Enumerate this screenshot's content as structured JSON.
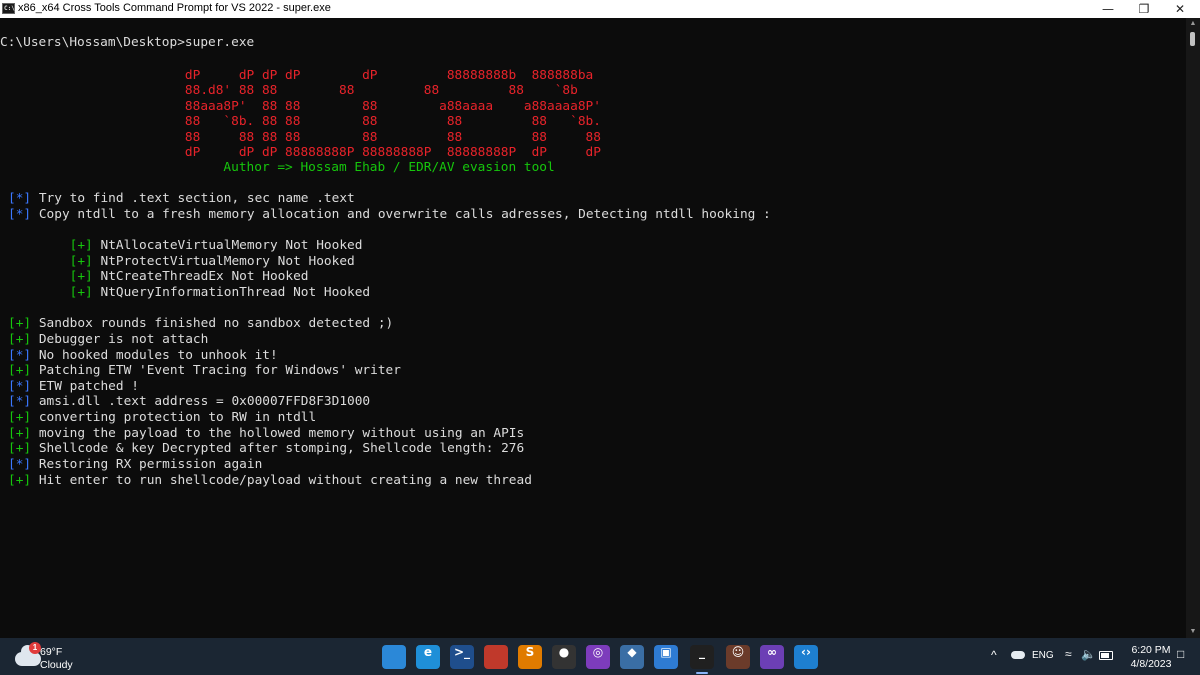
{
  "window": {
    "title": "x86_x64 Cross Tools Command Prompt for VS 2022 - super.exe",
    "icon_text": "C:\\",
    "minimize_icon": "minimize-icon",
    "restore_icon": "restore-icon",
    "close_icon": "close-icon"
  },
  "console": {
    "prompt": "C:\\Users\\Hossam\\Desktop>super.exe",
    "banner": [
      "                        dP     dP dP dP        dP         88888888b  888888ba ",
      "                        88.d8' 88 88        88         88         88    `8b",
      "                        88aaa8P'  88 88        88        a88aaaa    a88aaaa8P'",
      "                        88   `8b. 88 88        88         88         88   `8b.",
      "                        88     88 88 88        88         88         88     88",
      "                        dP     dP dP 88888888P 88888888P  88888888P  dP     dP"
    ],
    "author_line": "                             Author => Hossam Ehab / EDR/AV evasion tool",
    "lines": [
      {
        "mark": "[*]",
        "text": "Try to find .text section, sec name .text",
        "color": "blu",
        "indent": ""
      },
      {
        "mark": "[*]",
        "text": "Copy ntdll to a fresh memory allocation and overwrite calls adresses, Detecting ntdll hooking :",
        "color": "blu",
        "indent": ""
      },
      {
        "mark": "",
        "text": "",
        "color": "wht",
        "indent": ""
      },
      {
        "mark": "[+]",
        "text": "NtAllocateVirtualMemory Not Hooked",
        "color": "grn",
        "indent": "        "
      },
      {
        "mark": "[+]",
        "text": "NtProtectVirtualMemory Not Hooked",
        "color": "grn",
        "indent": "        "
      },
      {
        "mark": "[+]",
        "text": "NtCreateThreadEx Not Hooked",
        "color": "grn",
        "indent": "        "
      },
      {
        "mark": "[+]",
        "text": "NtQueryInformationThread Not Hooked",
        "color": "grn",
        "indent": "        "
      },
      {
        "mark": "",
        "text": "",
        "color": "wht",
        "indent": ""
      },
      {
        "mark": "[+]",
        "text": "Sandbox rounds finished no sandbox detected ;)",
        "color": "grn",
        "indent": ""
      },
      {
        "mark": "[+]",
        "text": "Debugger is not attach",
        "color": "grn",
        "indent": ""
      },
      {
        "mark": "[*]",
        "text": "No hooked modules to unhook it!",
        "color": "blu",
        "indent": ""
      },
      {
        "mark": "[+]",
        "text": "Patching ETW 'Event Tracing for Windows' writer",
        "color": "grn",
        "indent": ""
      },
      {
        "mark": "[*]",
        "text": "ETW patched !",
        "color": "blu",
        "indent": ""
      },
      {
        "mark": "[*]",
        "text": "amsi.dll .text address = 0x00007FFD8F3D1000",
        "color": "blu",
        "indent": ""
      },
      {
        "mark": "[+]",
        "text": "converting protection to RW in ntdll",
        "color": "grn",
        "indent": ""
      },
      {
        "mark": "[+]",
        "text": "moving the payload to the hollowed memory without using an APIs",
        "color": "grn",
        "indent": ""
      },
      {
        "mark": "[+]",
        "text": "Shellcode & key Decrypted after stomping, Shellcode length: 276",
        "color": "grn",
        "indent": ""
      },
      {
        "mark": "[*]",
        "text": "Restoring RX permission again",
        "color": "blu",
        "indent": ""
      },
      {
        "mark": "[+]",
        "text": "Hit enter to run shellcode/payload without creating a new thread",
        "color": "grn",
        "indent": ""
      }
    ]
  },
  "taskbar": {
    "weather": {
      "temp": "69°F",
      "condition": "Cloudy",
      "alert_count": "1",
      "icon": "cloud-icon"
    },
    "apps": [
      {
        "name": "start-button-icon",
        "glyph": "",
        "bg": "#2b88d8",
        "active": false
      },
      {
        "name": "edge-icon",
        "glyph": "e",
        "bg": "#1f8fd8",
        "active": false
      },
      {
        "name": "powershell-icon",
        "glyph": ">_",
        "bg": "#1f4e8c",
        "active": false
      },
      {
        "name": "color-grid-app-icon",
        "glyph": "",
        "bg": "#c0392b",
        "active": false
      },
      {
        "name": "sublime-icon",
        "glyph": "S",
        "bg": "#e07b00",
        "active": false
      },
      {
        "name": "chrome-app-icon",
        "glyph": "●",
        "bg": "#333333",
        "active": false
      },
      {
        "name": "tor-browser-icon",
        "glyph": "◎",
        "bg": "#7d3cbc",
        "active": false
      },
      {
        "name": "cube-app-icon",
        "glyph": "◆",
        "bg": "#3a6ea5",
        "active": false
      },
      {
        "name": "vmware-icon",
        "glyph": "▣",
        "bg": "#2e7bd3",
        "active": false
      },
      {
        "name": "terminal-icon",
        "glyph": "_",
        "bg": "#202020",
        "active": true
      },
      {
        "name": "profile-app-icon",
        "glyph": "☺",
        "bg": "#6b3b2a",
        "active": false
      },
      {
        "name": "visual-studio-icon",
        "glyph": "∞",
        "bg": "#6c3fb5",
        "active": false
      },
      {
        "name": "vscode-icon",
        "glyph": "‹›",
        "bg": "#1e7fd0",
        "active": false
      }
    ],
    "tray": {
      "chevron": "^",
      "language": "ENG",
      "wifi_icon": "wifi-icon",
      "volume_icon": "volume-icon",
      "battery_icon": "battery-icon",
      "time": "6:20 PM",
      "date": "4/8/2023"
    }
  }
}
